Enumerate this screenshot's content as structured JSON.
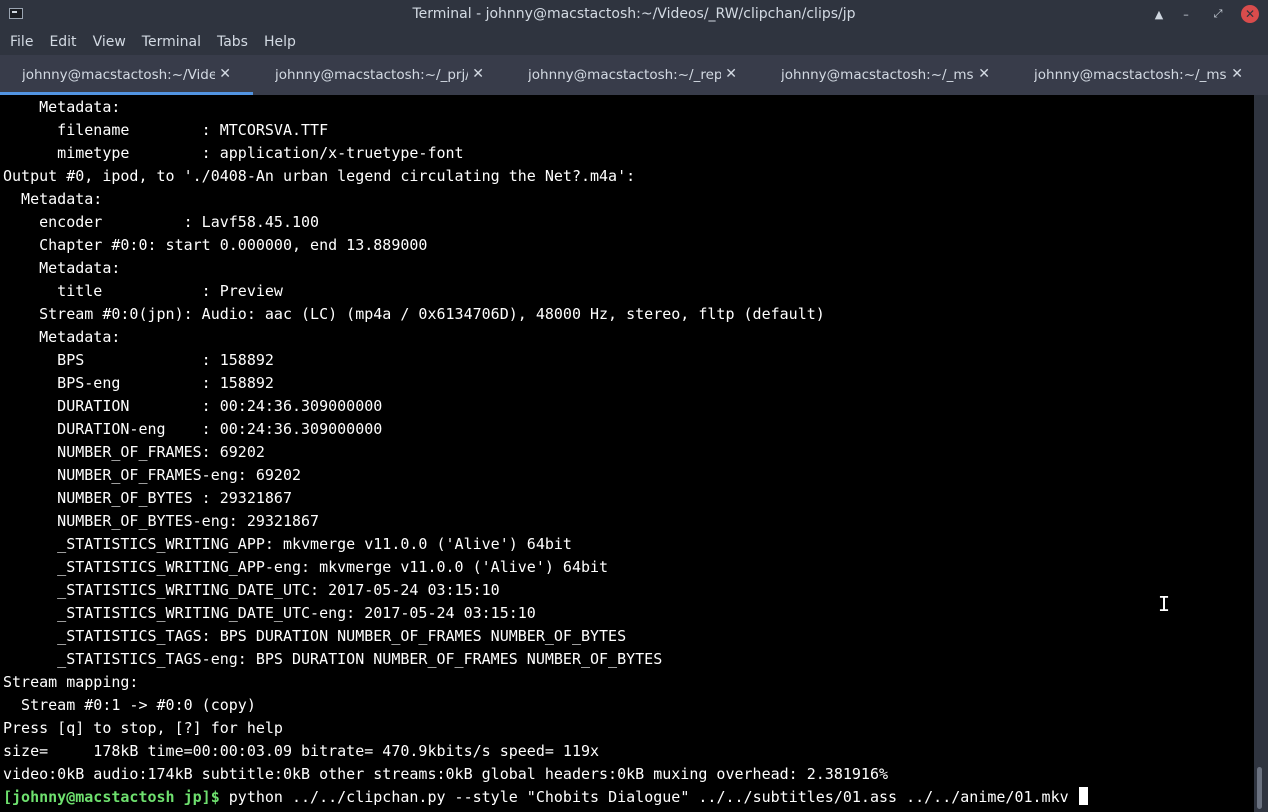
{
  "window": {
    "title": "Terminal - johnny@macstactosh:~/Videos/_RW/clipchan/clips/jp",
    "buttons": {
      "up": "▲",
      "minimize": "–",
      "maximize": "⤢",
      "close": "✕"
    }
  },
  "menu": [
    "File",
    "Edit",
    "View",
    "Terminal",
    "Tabs",
    "Help"
  ],
  "tabs": [
    {
      "label": "johnny@macstactosh:~/Video...",
      "active": true
    },
    {
      "label": "johnny@macstactosh:~/_prj/t...",
      "active": false
    },
    {
      "label": "johnny@macstactosh:~/_repo...",
      "active": false
    },
    {
      "label": "johnny@macstactosh:~/_msc/...",
      "active": false
    },
    {
      "label": "johnny@macstactosh:~/_msc/...",
      "active": false
    }
  ],
  "terminal": {
    "lines": [
      "    Metadata:",
      "      filename        : MTCORSVA.TTF",
      "      mimetype        : application/x-truetype-font",
      "Output #0, ipod, to './0408-An urban legend circulating the Net?.m4a':",
      "  Metadata:",
      "    encoder         : Lavf58.45.100",
      "    Chapter #0:0: start 0.000000, end 13.889000",
      "    Metadata:",
      "      title           : Preview",
      "    Stream #0:0(jpn): Audio: aac (LC) (mp4a / 0x6134706D), 48000 Hz, stereo, fltp (default)",
      "    Metadata:",
      "      BPS             : 158892",
      "      BPS-eng         : 158892",
      "      DURATION        : 00:24:36.309000000",
      "      DURATION-eng    : 00:24:36.309000000",
      "      NUMBER_OF_FRAMES: 69202",
      "      NUMBER_OF_FRAMES-eng: 69202",
      "      NUMBER_OF_BYTES : 29321867",
      "      NUMBER_OF_BYTES-eng: 29321867",
      "      _STATISTICS_WRITING_APP: mkvmerge v11.0.0 ('Alive') 64bit",
      "      _STATISTICS_WRITING_APP-eng: mkvmerge v11.0.0 ('Alive') 64bit",
      "      _STATISTICS_WRITING_DATE_UTC: 2017-05-24 03:15:10",
      "      _STATISTICS_WRITING_DATE_UTC-eng: 2017-05-24 03:15:10",
      "      _STATISTICS_TAGS: BPS DURATION NUMBER_OF_FRAMES NUMBER_OF_BYTES",
      "      _STATISTICS_TAGS-eng: BPS DURATION NUMBER_OF_FRAMES NUMBER_OF_BYTES",
      "Stream mapping:",
      "  Stream #0:1 -> #0:0 (copy)",
      "Press [q] to stop, [?] for help",
      "size=     178kB time=00:00:03.09 bitrate= 470.9kbits/s speed= 119x",
      "video:0kB audio:174kB subtitle:0kB other streams:0kB global headers:0kB muxing overhead: 2.381916%"
    ],
    "prompt": "[johnny@macstactosh jp]$",
    "command": " python ../../clipchan.py --style \"Chobits Dialogue\" ../../subtitles/01.ass ../../anime/01.mkv "
  },
  "colors": {
    "chrome": "#2f343f",
    "tab_bg": "#383c4a",
    "accent": "#5294e2",
    "prompt": "#6ee06e",
    "close_button": "#d94c4c"
  }
}
